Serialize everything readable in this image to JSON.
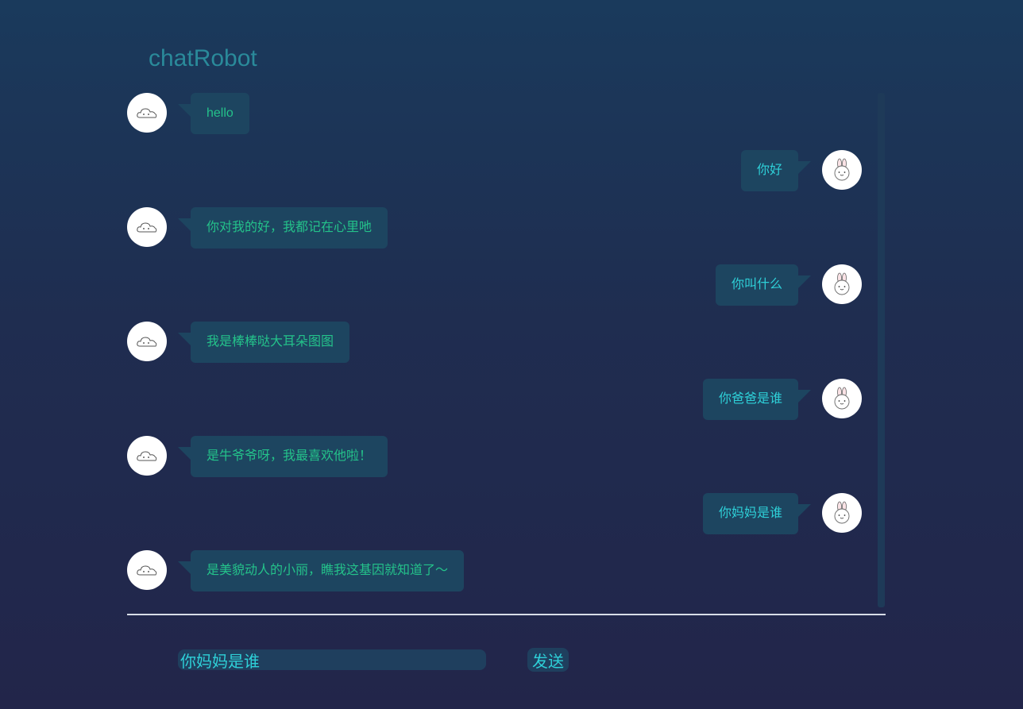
{
  "app": {
    "title": "chatRobot"
  },
  "messages": [
    {
      "from": "bot",
      "text": "hello"
    },
    {
      "from": "user",
      "text": "你好"
    },
    {
      "from": "bot",
      "text": "你对我的好，我都记在心里吔"
    },
    {
      "from": "user",
      "text": "你叫什么"
    },
    {
      "from": "bot",
      "text": "我是棒棒哒大耳朵图图"
    },
    {
      "from": "user",
      "text": "你爸爸是谁"
    },
    {
      "from": "bot",
      "text": "是牛爷爷呀，我最喜欢他啦！"
    },
    {
      "from": "user",
      "text": "你妈妈是谁"
    },
    {
      "from": "bot",
      "text": "是美貌动人的小丽，瞧我这基因就知道了～"
    }
  ],
  "composer": {
    "value": "你妈妈是谁",
    "send_label": "发送"
  },
  "icons": {
    "bot_avatar": "cloud-avatar-icon",
    "user_avatar": "bunny-avatar-icon"
  },
  "colors": {
    "bot_text": "#24c28a",
    "user_text": "#2ed0d8",
    "bubble_bg": "#1d4560",
    "title": "#2a8a9a"
  }
}
